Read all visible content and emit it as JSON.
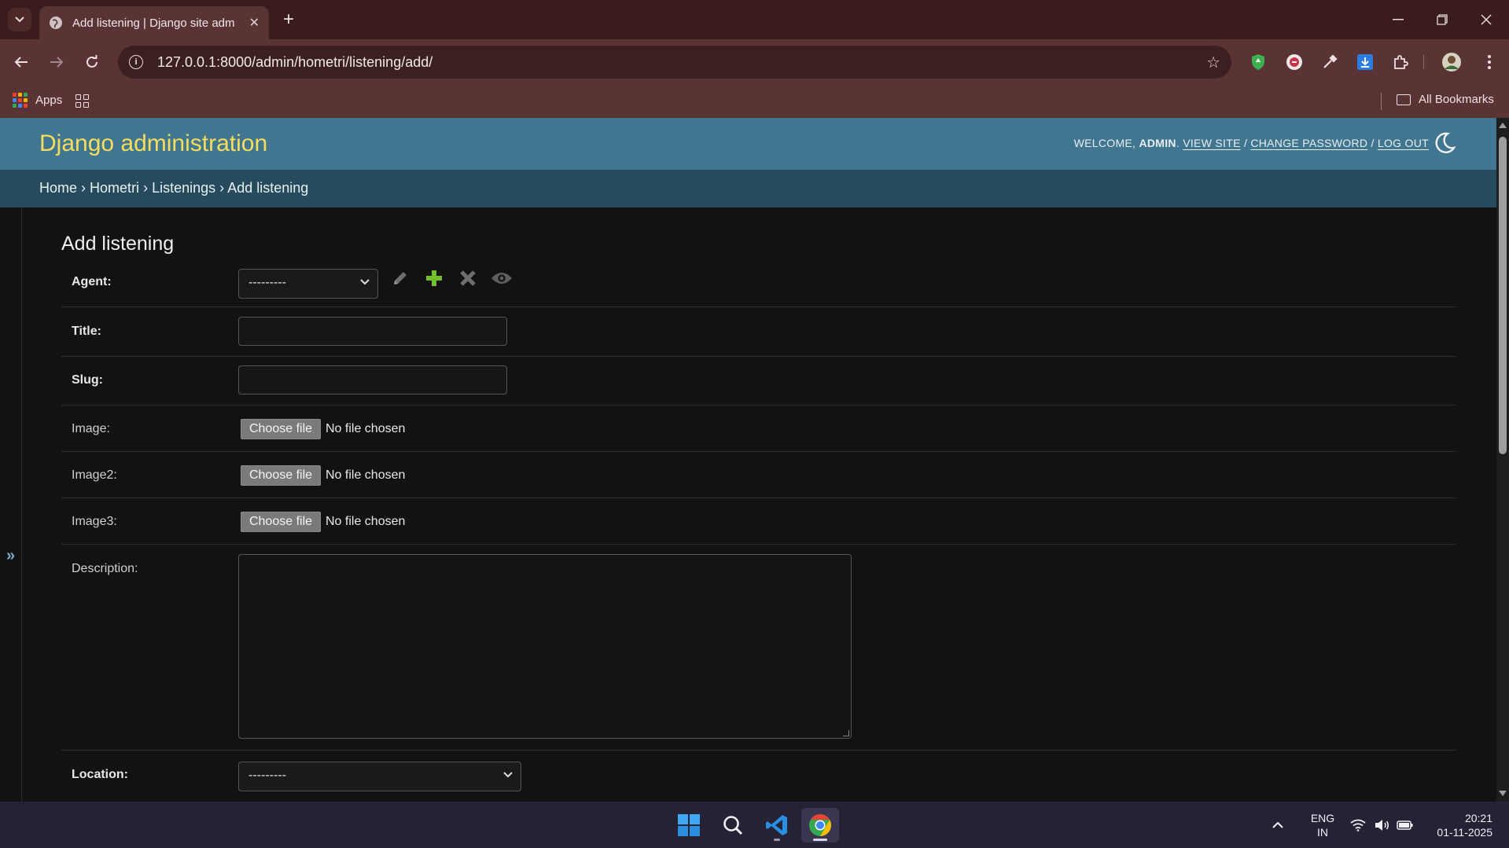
{
  "browser": {
    "tab_title": "Add listening | Django site adm",
    "url": "127.0.0.1:8000/admin/hometri/listening/add/",
    "bookmarks": {
      "apps_label": "Apps",
      "all_label": "All Bookmarks"
    }
  },
  "admin": {
    "brand": "Django administration",
    "user_tools": {
      "welcome": "WELCOME,",
      "username": "ADMIN",
      "view_site": "VIEW SITE",
      "change_password": "CHANGE PASSWORD",
      "log_out": "LOG OUT",
      "sep": "/"
    },
    "breadcrumbs": [
      "Home",
      "Hometri",
      "Listenings",
      "Add listening"
    ],
    "breadcrumb_sep": "›",
    "nav_toggle": "»",
    "page_title": "Add listening",
    "form": {
      "agent": {
        "label": "Agent:",
        "value": "---------"
      },
      "title": {
        "label": "Title:",
        "value": ""
      },
      "slug": {
        "label": "Slug:",
        "value": ""
      },
      "image": {
        "label": "Image:",
        "button": "Choose file",
        "status": "No file chosen"
      },
      "image2": {
        "label": "Image2:",
        "button": "Choose file",
        "status": "No file chosen"
      },
      "image3": {
        "label": "Image3:",
        "button": "Choose file",
        "status": "No file chosen"
      },
      "description": {
        "label": "Description:",
        "value": ""
      },
      "location": {
        "label": "Location:",
        "value": "---------"
      }
    },
    "colors": {
      "header": "#417690",
      "breadcrumbs": "#264b5d",
      "brand": "#f5dd5d",
      "add_green": "#70bf2b"
    }
  },
  "taskbar": {
    "lang_line1": "ENG",
    "lang_line2": "IN",
    "time": "20:21",
    "date": "01-11-2025"
  }
}
